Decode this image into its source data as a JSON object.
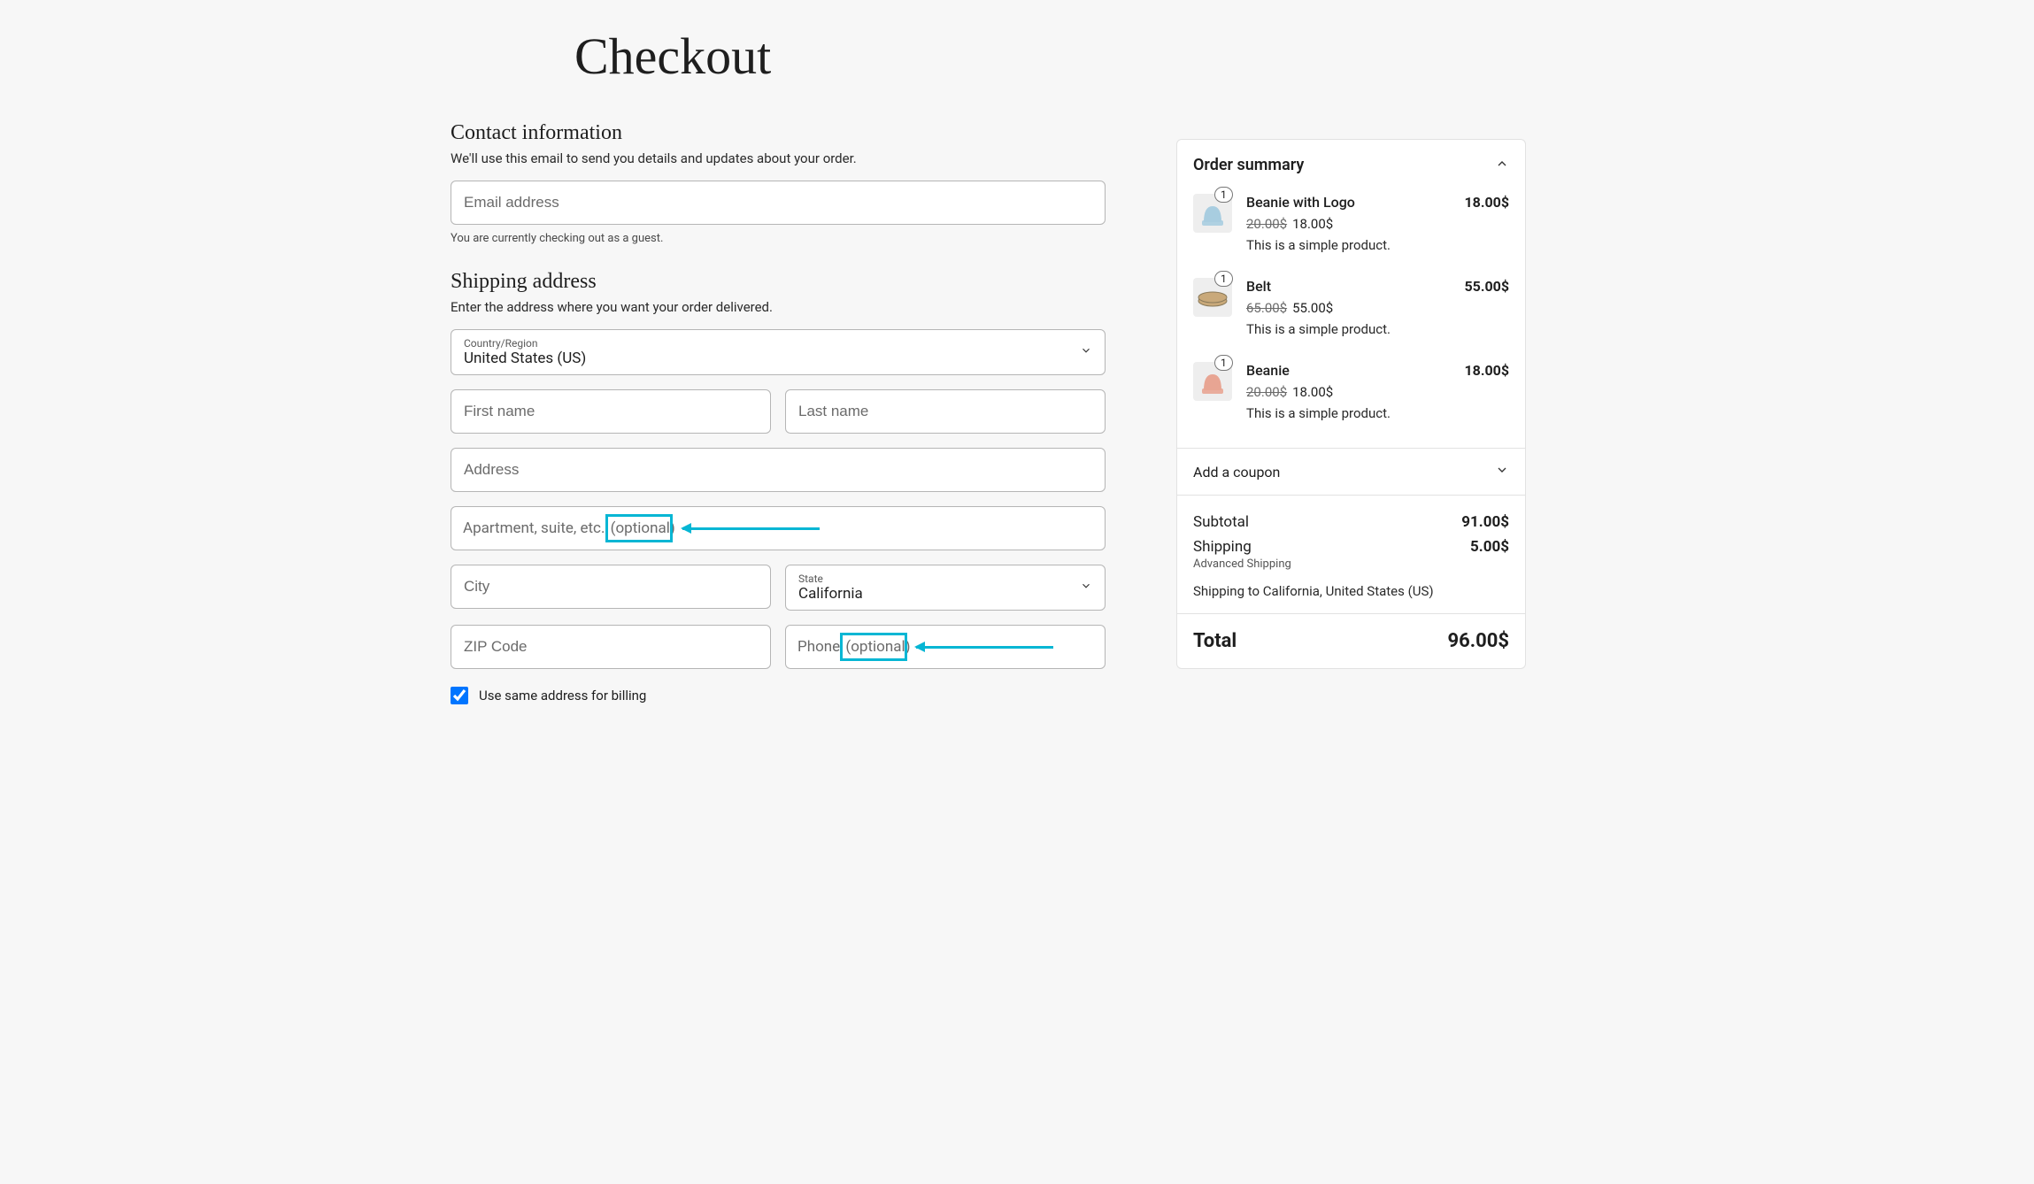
{
  "page": {
    "title": "Checkout"
  },
  "contact": {
    "heading": "Contact information",
    "sub": "We'll use this email to send you details and updates about your order.",
    "email_placeholder": "Email address",
    "guest_note": "You are currently checking out as a guest."
  },
  "shipping": {
    "heading": "Shipping address",
    "sub": "Enter the address where you want your order delivered.",
    "country_label": "Country/Region",
    "country_value": "United States (US)",
    "first_name_placeholder": "First name",
    "last_name_placeholder": "Last name",
    "address_placeholder": "Address",
    "apt_placeholder_main": "Apartment, suite, etc. ",
    "apt_placeholder_opt": "(optional)",
    "city_placeholder": "City",
    "state_label": "State",
    "state_value": "California",
    "zip_placeholder": "ZIP Code",
    "phone_placeholder_main": "Phone ",
    "phone_placeholder_opt": "(optional)",
    "same_billing": "Use same address for billing"
  },
  "summary": {
    "heading": "Order summary",
    "items": [
      {
        "qty": "1",
        "name": "Beanie with Logo",
        "price": "18.00$",
        "old": "20.00$",
        "new": "18.00$",
        "desc": "This is a simple product.",
        "color": "#a8cde0"
      },
      {
        "qty": "1",
        "name": "Belt",
        "price": "55.00$",
        "old": "65.00$",
        "new": "55.00$",
        "desc": "This is a simple product.",
        "color": "#c9a97a"
      },
      {
        "qty": "1",
        "name": "Beanie",
        "price": "18.00$",
        "old": "20.00$",
        "new": "18.00$",
        "desc": "This is a simple product.",
        "color": "#e8a593"
      }
    ],
    "coupon": "Add a coupon",
    "subtotal_label": "Subtotal",
    "subtotal": "91.00$",
    "shipping_label": "Shipping",
    "shipping": "5.00$",
    "shipping_method": "Advanced Shipping",
    "shipping_to": "Shipping to California, United States (US)",
    "total_label": "Total",
    "total": "96.00$"
  }
}
